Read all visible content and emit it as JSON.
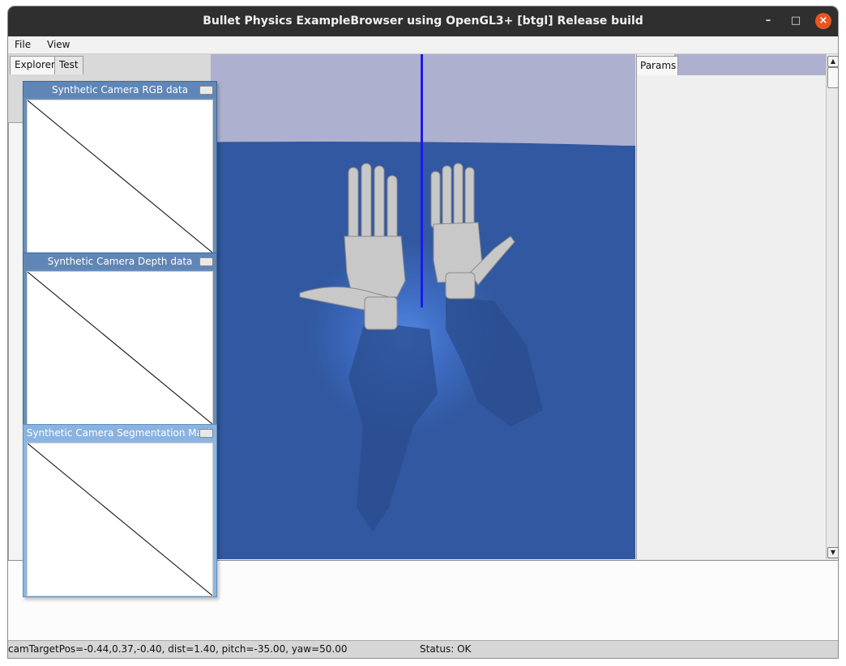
{
  "window": {
    "title": "Bullet Physics ExampleBrowser using OpenGL3+ [btgl] Release build",
    "controls": {
      "minimize": "–",
      "maximize": "□",
      "close": "×"
    }
  },
  "menu": {
    "file": "File",
    "view": "View"
  },
  "left_tabs": {
    "explorer": "Explorer",
    "test": "Test"
  },
  "camera_windows": [
    {
      "title": "Synthetic Camera RGB data"
    },
    {
      "title": "Synthetic Camera Depth data"
    },
    {
      "title": "Synthetic Camera Segmentation Mask"
    }
  ],
  "params": {
    "tab": "Params"
  },
  "status": {
    "camera": "camTargetPos=-0.44,0.37,-0.40, dist=1.40, pitch=-35.00, yaw=50.00",
    "state": "Status: OK"
  },
  "colors": {
    "sky": "#aeb0cf",
    "floor": "#3158a0",
    "axis": "#1a1ae6",
    "close_button": "#e95420"
  }
}
